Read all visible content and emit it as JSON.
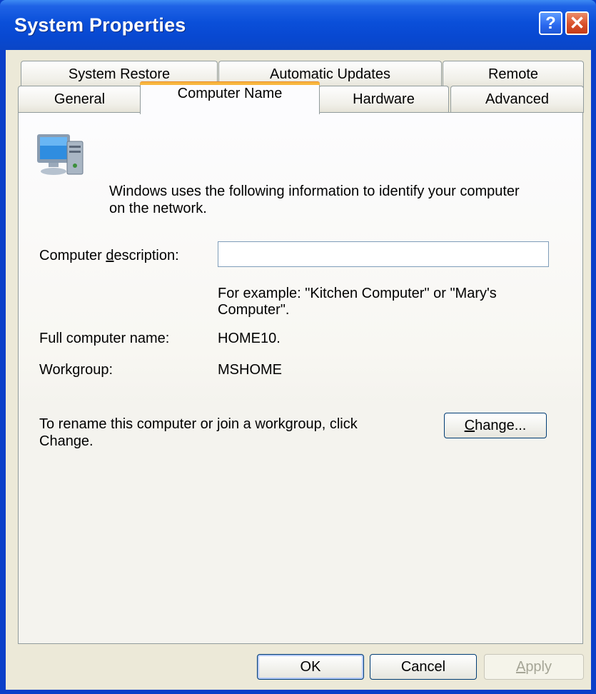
{
  "window": {
    "title": "System Properties",
    "help_glyph": "?",
    "close_glyph": "✕"
  },
  "tabs": {
    "row1": [
      "System Restore",
      "Automatic Updates",
      "Remote"
    ],
    "row2": [
      "General",
      "Computer Name",
      "Hardware",
      "Advanced"
    ],
    "active": "Computer Name"
  },
  "panel": {
    "intro_line1": "Windows uses the following information to identify your computer",
    "intro_line2": "on the network.",
    "description_label_pre": "Computer ",
    "description_label_accel": "d",
    "description_label_post": "escription:",
    "description_value": "",
    "example_line1": "For example: \"Kitchen Computer\" or \"Mary's",
    "example_line2": "Computer\".",
    "full_name_label": "Full computer name:",
    "full_name_value": "HOME10.",
    "workgroup_label": "Workgroup:",
    "workgroup_value": "MSHOME",
    "rename_line1": "To rename this computer or join a workgroup, click",
    "rename_line2": "Change.",
    "change_accel": "C",
    "change_rest": "hange..."
  },
  "buttons": {
    "ok": "OK",
    "cancel": "Cancel",
    "apply_accel": "A",
    "apply_rest": "pply"
  },
  "colors": {
    "titlebar": "#0a4fd9",
    "dialog_bg": "#ece9d8",
    "active_tab_accent": "#f8b63e"
  }
}
